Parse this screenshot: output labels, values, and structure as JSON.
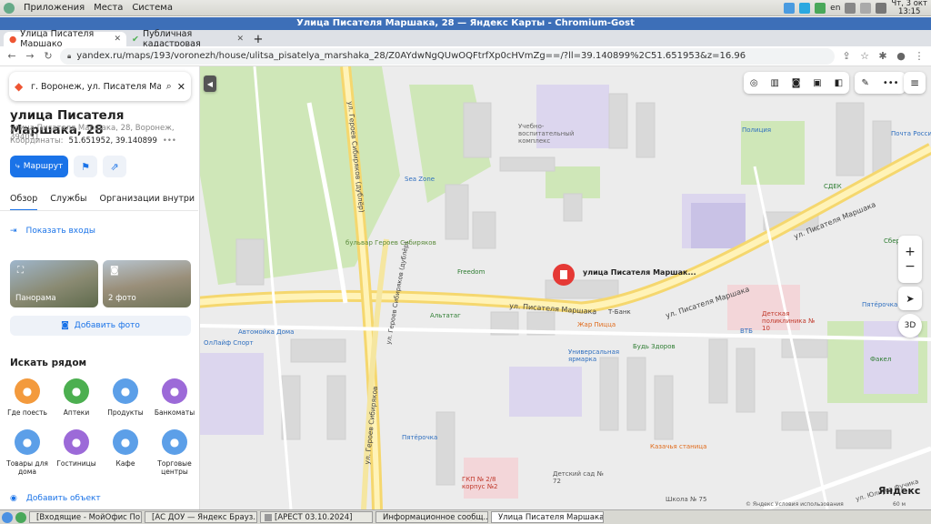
{
  "os": {
    "menu": [
      "Приложения",
      "Места",
      "Система"
    ],
    "lang": "en",
    "clock_day": "Чт,  3 окт",
    "clock_time": "13:15"
  },
  "window_title": "Улица Писателя Маршака, 28 — Яндекс Карты - Chromium-Gost",
  "tabs": [
    {
      "label": "Улица Писателя Маршако",
      "active": true
    },
    {
      "label": "Публичная кадастровая",
      "active": false
    }
  ],
  "url": "yandex.ru/maps/193/voronezh/house/ulitsa_pisatelya_marshaka_28/Z0AYdwNgQUwOQFtrfXp0cHVmZg==/?ll=39.140899%2C51.651953&z=16.96",
  "panel": {
    "search_value": "г. Воронеж, ул. Писателя Маршака",
    "title": "улица Писателя Маршака, 28",
    "subaddress": "улица Писателя Маршака, 28, Воронеж, 394051",
    "coords_label": "Координаты:",
    "coords_value": "51.651952, 39.140899",
    "route_label": "Маршрут",
    "tabs": [
      "Обзор",
      "Службы",
      "Организации внутри"
    ],
    "show_entrances": "Показать входы",
    "photo1_label": "Панорама",
    "photo2_label": "2 фото",
    "add_photo": "Добавить фото",
    "nearby_title": "Искать рядом",
    "categories": [
      {
        "label": "Где поесть",
        "color": "#f39a3d",
        "icon": "fork-icon"
      },
      {
        "label": "Аптеки",
        "color": "#4caf50",
        "icon": "cross-icon"
      },
      {
        "label": "Продукты",
        "color": "#5c9fe8",
        "icon": "basket-icon"
      },
      {
        "label": "Банкоматы",
        "color": "#9c6ad8",
        "icon": "ruble-icon"
      },
      {
        "label": "Товары для дома",
        "color": "#5c9fe8",
        "icon": "bag-icon"
      },
      {
        "label": "Гостиницы",
        "color": "#9c6ad8",
        "icon": "bed-icon"
      },
      {
        "label": "Кафе",
        "color": "#5c9fe8",
        "icon": "cup-icon"
      },
      {
        "label": "Торговые центры",
        "color": "#5c9fe8",
        "icon": "shop-icon"
      }
    ],
    "add_object": "Добавить объект"
  },
  "map": {
    "pin_label": "улица Писателя Маршак...",
    "street_main": "ул. Писателя Маршака",
    "street_main2": "ул. Писателя Маршака",
    "street_right": "ул. Писателя Маршака",
    "street_geroev": "ул. Героев Сибиряков",
    "street_geroev2": "ул. Героев Сибиряков (дублёр)",
    "street_geroev3": "ул. Героев Сибиряков (дублёр)",
    "boulevard": "бульвар Героев Сибиряков",
    "street_yulius": "ул. Юлиуса Фучика",
    "pois": [
      {
        "name": "Полиция"
      },
      {
        "name": "Почта России"
      },
      {
        "name": "СДЕК"
      },
      {
        "name": "Сбербанк"
      },
      {
        "name": "Sea Zone"
      },
      {
        "name": "Freedom"
      },
      {
        "name": "Альтатаг"
      },
      {
        "name": "Т-Банк"
      },
      {
        "name": "ВТБ"
      },
      {
        "name": "Жар Пицца"
      },
      {
        "name": "Будь Здоров"
      },
      {
        "name": "Универсальная ярмарка"
      },
      {
        "name": "Пятёрочка"
      },
      {
        "name": "Пятёрочка"
      },
      {
        "name": "Казачья станица"
      },
      {
        "name": "Детская поликлиника № 10"
      },
      {
        "name": "Факел"
      },
      {
        "name": "Школа № 75"
      },
      {
        "name": "Детский сад № 72"
      },
      {
        "name": "ГКП № 2/8 корпус №2"
      },
      {
        "name": "ОлЛайф Спорт"
      },
      {
        "name": "Автомойка Дома"
      },
      {
        "name": "Учебно-воспитательный комплекс"
      }
    ],
    "logo": "Яндекс",
    "footer": "© Яндекс  Условия использования",
    "scale": "60 м",
    "btn_3d": "3D",
    "zoom_in": "+",
    "zoom_out": "−"
  },
  "taskbar": [
    {
      "label": "[Входящие - МойОфис По...",
      "active": false
    },
    {
      "label": "[АС ДОУ — Яндекс Брауз...",
      "active": false
    },
    {
      "label": "[АРЕСТ 03.10.2024]",
      "active": false
    },
    {
      "label": "Информационное сообщ...",
      "active": false
    },
    {
      "label": "Улица Писателя Маршака...",
      "active": true
    }
  ]
}
